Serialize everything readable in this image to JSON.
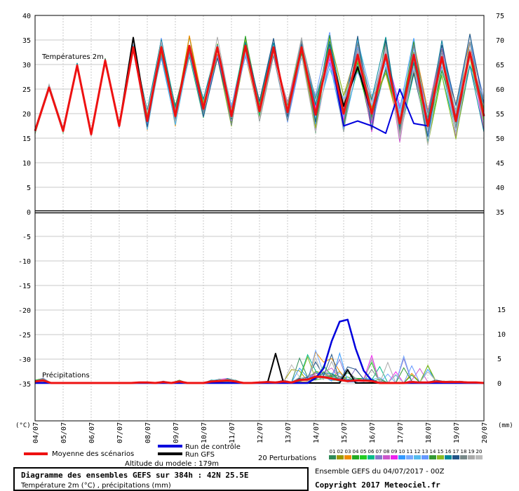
{
  "chart_data": {
    "type": "line",
    "title": "Diagramme des ensembles GEFS sur 384h : 42N 25.5E",
    "subtitle": "Température 2m (°C) , précipitations (mm)",
    "altitude": "Altitude du modele : 179m",
    "ensemble_info": "Ensemble GEFS du 04/07/2017 - 00Z",
    "copyright": "Copyright 2017 Meteociel.fr",
    "panel_temp_label": "Températures 2m",
    "panel_precip_label": "Précipitations",
    "left_unit": "(°C)",
    "right_unit": "(mm)",
    "x_dates": [
      "04/07",
      "05/07",
      "06/07",
      "07/07",
      "08/07",
      "09/07",
      "10/07",
      "11/07",
      "12/07",
      "13/07",
      "14/07",
      "15/07",
      "16/07",
      "17/07",
      "18/07",
      "19/07",
      "20/07"
    ],
    "left_ticks": [
      40,
      35,
      30,
      25,
      20,
      15,
      10,
      5,
      0,
      -5,
      -10,
      -15,
      -20,
      -25,
      -30,
      -35
    ],
    "right_ticks_temp": [
      75,
      70,
      65,
      60,
      55,
      50,
      45,
      40,
      35
    ],
    "right_ticks_precip": [
      15,
      10,
      5,
      0
    ],
    "legend": {
      "moyenne": "Moyenne des scénarios",
      "controle": "Run de contrôle",
      "gfs": "Run GFS",
      "perturbations": "20 Perturbations",
      "member_numbers": [
        "01",
        "02",
        "03",
        "04",
        "05",
        "06",
        "07",
        "08",
        "09",
        "10",
        "11",
        "12",
        "13",
        "14",
        "15",
        "16",
        "17",
        "18",
        "19",
        "20"
      ]
    },
    "colors": {
      "moyenne": "#ee1111",
      "controle": "#0000dd",
      "gfs": "#000000",
      "members": [
        "#2e8b57",
        "#999900",
        "#f08c00",
        "#22aa22",
        "#22cc22",
        "#00bb88",
        "#8877cc",
        "#cc55cc",
        "#ee22ee",
        "#3399ff",
        "#77aaff",
        "#55bbee",
        "#6699ff",
        "#339933",
        "#88bb22",
        "#008899",
        "#225588",
        "#778888",
        "#aaaaaa",
        "#bbbbbb"
      ]
    },
    "series_temp": {
      "moyenne": [
        16.5,
        25.3,
        16.5,
        29.8,
        15.8,
        30.8,
        17.5,
        33.5,
        18.5,
        33.5,
        19.5,
        33.8,
        21,
        33.5,
        19.5,
        33.8,
        20.5,
        33.5,
        20.3,
        33.5,
        19.8,
        33,
        20,
        32,
        20,
        32,
        18,
        32,
        17.5,
        31.5,
        18.5,
        32.5,
        19.5
      ],
      "controle": [
        16.5,
        25.3,
        16.5,
        29.8,
        15.8,
        30.8,
        17.5,
        33.5,
        18.5,
        33.5,
        19.5,
        33.8,
        21,
        33.5,
        19.5,
        33.8,
        20.5,
        33.5,
        20.3,
        33.5,
        19.8,
        33,
        17.5,
        18.5,
        17.5,
        16,
        25,
        18,
        17.5,
        31.5,
        18.5,
        32.5,
        19.5
      ],
      "gfs": [
        16.5,
        25.3,
        16.5,
        29.8,
        15.8,
        30.8,
        17.5,
        35.5,
        18.5,
        33.5,
        19.5,
        33.8,
        21,
        33.5,
        19.5,
        33.8,
        20.5,
        33.5,
        20.3,
        33.5,
        19.8,
        33,
        21.5,
        29.5,
        20,
        32,
        18,
        32,
        17.5,
        31.5,
        18.5,
        32.5,
        19.5
      ]
    },
    "series_precip": {
      "moyenne": [
        0.3,
        0.5,
        0,
        0,
        0,
        0,
        0,
        0,
        0,
        0,
        0,
        0,
        0,
        0.1,
        0.1,
        0,
        0.2,
        0,
        0.3,
        0,
        0,
        0,
        0.3,
        0.4,
        0.5,
        0.3,
        0,
        0,
        0.1,
        0.2,
        0.1,
        0.3,
        0.1,
        0.6,
        0.7,
        1.3,
        1.2,
        0.9,
        0.6,
        0.4,
        0.5,
        0.5,
        0.4,
        0,
        0,
        0,
        0,
        0.2,
        0.1,
        0.1,
        0.3,
        0.2,
        0.2,
        0.2,
        0.1,
        0.1,
        0
      ],
      "controle": [
        0,
        0,
        0,
        0,
        0,
        0,
        0,
        0,
        0,
        0,
        0,
        0,
        0,
        0,
        0,
        0,
        0,
        0,
        0,
        0,
        0,
        0,
        0,
        0,
        0,
        0,
        0,
        0,
        0,
        0,
        0,
        0,
        0,
        0,
        0,
        1,
        3,
        8.5,
        12.5,
        12.9,
        7,
        2.5,
        0.5,
        0,
        0,
        0,
        0,
        0,
        0,
        0,
        0,
        0,
        0,
        0,
        0,
        0,
        0
      ],
      "gfs": [
        0,
        0,
        0,
        0,
        0,
        0,
        0,
        0,
        0,
        0,
        0,
        0,
        0,
        0,
        0,
        0,
        0,
        0,
        0,
        0,
        0,
        0,
        0,
        0,
        0,
        0,
        0,
        0,
        0,
        0,
        6,
        0,
        0,
        0,
        0,
        0,
        0,
        0,
        0,
        2.7,
        0,
        0,
        0,
        0,
        0,
        0,
        0,
        0,
        0,
        0,
        0,
        0,
        0,
        0,
        0,
        0,
        0
      ]
    }
  }
}
